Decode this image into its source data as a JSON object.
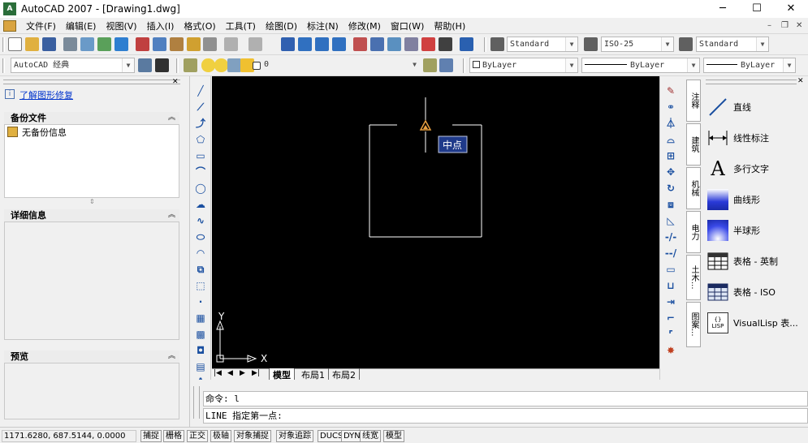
{
  "window": {
    "title": "AutoCAD 2007 - [Drawing1.dwg]",
    "app_icon": "autocad-logo-icon",
    "min_glyph": "─",
    "max_glyph": "☐",
    "close_glyph": "✕"
  },
  "menu": [
    "文件(F)",
    "编辑(E)",
    "视图(V)",
    "插入(I)",
    "格式(O)",
    "工具(T)",
    "绘图(D)",
    "标注(N)",
    "修改(M)",
    "窗口(W)",
    "帮助(H)"
  ],
  "styles_toolbar": {
    "text_style": "Standard",
    "dim_style": "ISO-25",
    "table_style": "Standard"
  },
  "workspace": {
    "name": "AutoCAD 经典"
  },
  "layer": {
    "current": "0"
  },
  "properties": {
    "color": "ByLayer",
    "linetype": "ByLayer",
    "lineweight": "ByLayer"
  },
  "left_panel": {
    "link": "了解图形修复",
    "backup_header": "备份文件",
    "backup_item": "无备份信息",
    "details_header": "详细信息",
    "preview_header": "预览"
  },
  "canvas": {
    "tooltip": "中点",
    "ucs_x": "X",
    "ucs_y": "Y",
    "background": "#000000",
    "geometry_color": "#ffffff",
    "marker_color": "#e8a040"
  },
  "tabs": [
    "模型",
    "布局1",
    "布局2"
  ],
  "tool_palette": {
    "side_tabs": [
      "注释",
      "建筑",
      "机械",
      "电力",
      "土木...",
      "图案..."
    ],
    "items": [
      {
        "label": "直线",
        "icon": "line-tool-icon"
      },
      {
        "label": "线性标注",
        "icon": "linear-dimension-icon"
      },
      {
        "label": "多行文字",
        "icon": "mtext-icon"
      },
      {
        "label": "曲线形",
        "icon": "curved-gradient-icon"
      },
      {
        "label": "半球形",
        "icon": "hemisphere-gradient-icon"
      },
      {
        "label": "表格 - 英制",
        "icon": "table-imperial-icon"
      },
      {
        "label": "表格 - ISO",
        "icon": "table-iso-icon"
      },
      {
        "label": "VisualLisp 表...",
        "icon": "visuallisp-icon"
      }
    ]
  },
  "command": {
    "line1": "命令: l",
    "line2": "LINE 指定第一点:"
  },
  "status": {
    "coords": "1171.6280,  687.5144,  0.0000",
    "buttons": [
      "捕捉",
      "栅格",
      "正交",
      "极轴",
      "对象捕捉",
      "对象追踪",
      "DUCS",
      "DYN",
      "线宽",
      "模型"
    ]
  }
}
